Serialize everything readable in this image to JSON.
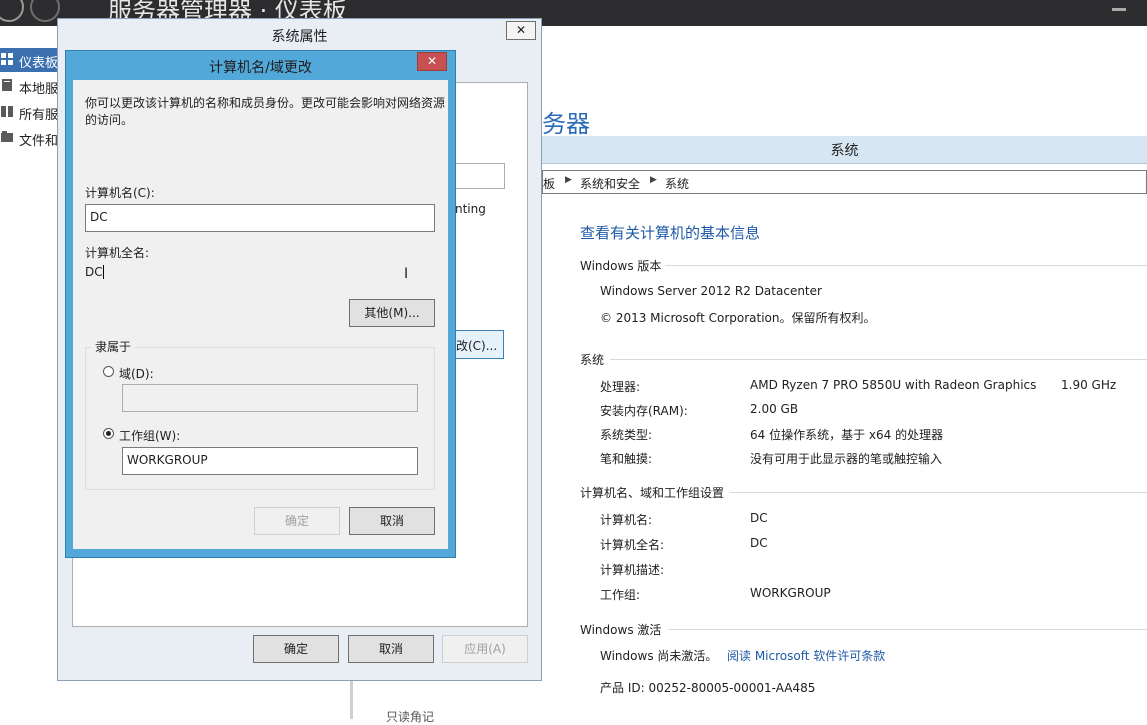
{
  "server_manager": {
    "title": "服务器管理器 · 仪表板",
    "nav": [
      {
        "label": "仪表板",
        "icon": "dashboard-icon",
        "selected": true
      },
      {
        "label": "本地服",
        "icon": "server-icon"
      },
      {
        "label": "所有服",
        "icon": "servers-icon"
      },
      {
        "label": "文件和",
        "icon": "folder-icon"
      }
    ],
    "bottom_fragment": "只读角记"
  },
  "control_panel": {
    "heading_fragment": "务器",
    "window_title": "系统",
    "breadcrumbs": [
      "板",
      "系统和安全",
      "系统"
    ],
    "main_title": "查看有关计算机的基本信息",
    "windows_edition": {
      "section": "Windows 版本",
      "edition": "Windows Server 2012 R2 Datacenter",
      "copyright": "© 2013 Microsoft Corporation。保留所有权利。"
    },
    "system": {
      "section": "系统",
      "rows": [
        {
          "label": "处理器:",
          "value": "AMD Ryzen 7 PRO 5850U with Radeon Graphics",
          "extra": "1.90 GHz"
        },
        {
          "label": "安装内存(RAM):",
          "value": "2.00 GB"
        },
        {
          "label": "系统类型:",
          "value": "64 位操作系统，基于 x64 的处理器"
        },
        {
          "label": "笔和触摸:",
          "value": "没有可用于此显示器的笔或触控输入"
        }
      ]
    },
    "computer_name": {
      "section": "计算机名、域和工作组设置",
      "rows": [
        {
          "label": "计算机名:",
          "value": "DC"
        },
        {
          "label": "计算机全名:",
          "value": "DC"
        },
        {
          "label": "计算机描述:",
          "value": ""
        },
        {
          "label": "工作组:",
          "value": "WORKGROUP"
        }
      ]
    },
    "activation": {
      "section": "Windows 激活",
      "status": "Windows 尚未激活。",
      "link": "阅读 Microsoft 软件许可条款",
      "product_id": "产品 ID: 00252-80005-00001-AA485"
    }
  },
  "system_properties": {
    "title": "系统属性",
    "close": "✕",
    "text_fragment": "nting",
    "button_fragment": "改(C)...",
    "buttons": {
      "ok": "确定",
      "cancel": "取消",
      "apply": "应用(A)"
    }
  },
  "computer_name_dialog": {
    "title": "计算机名/域更改",
    "close": "✕",
    "description": "你可以更改该计算机的名称和成员身份。更改可能会影响对网络资源的访问。",
    "computer_name_label": "计算机名(C):",
    "computer_name_value": "DC",
    "full_name_label": "计算机全名:",
    "full_name_value": "DC",
    "more_button": "其他(M)...",
    "member_of": {
      "title": "隶属于",
      "domain_label": "域(D):",
      "domain_value": "",
      "workgroup_label": "工作组(W):",
      "workgroup_value": "WORKGROUP",
      "selected": "workgroup"
    },
    "buttons": {
      "ok": "确定",
      "cancel": "取消"
    }
  },
  "colors": {
    "accent_blue": "#1f5aa6",
    "dialog_frame": "#52a8d8",
    "close_red": "#c75050",
    "selected_nav": "#3a6fb0"
  }
}
